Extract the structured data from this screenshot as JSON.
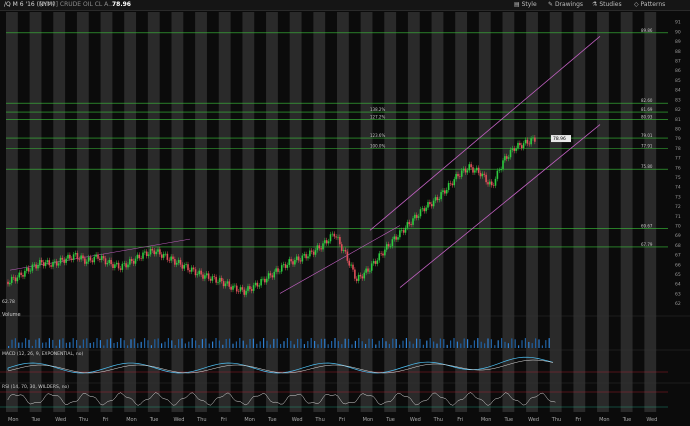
{
  "header": {
    "symbol": "/Q M 6 '16 (NYM)",
    "description": "[NYM] CRUDE OIL CL A...",
    "last_price": "78.96",
    "buttons": [
      {
        "label": "Style",
        "icon": "style-icon"
      },
      {
        "label": "Drawings",
        "icon": "pencil-icon"
      },
      {
        "label": "Studies",
        "icon": "flask-icon"
      },
      {
        "label": "Patterns",
        "icon": "patterns-icon"
      }
    ]
  },
  "lower_panes": {
    "volume_label": "Volume",
    "macd_label": "MACD (12, 26, 9, EXPONENTIAL, no)",
    "rsi_label": "RSI (14, 70, 30, WILDERS, no)"
  },
  "colors": {
    "up": "#2ecc40",
    "down": "#e0505a",
    "fib_line": "#3bbf3b",
    "channel": "#c060c0",
    "session_band": "#2a2a2a",
    "background": "#0b0b0b"
  },
  "chart_data": {
    "type": "candlestick",
    "ylim": [
      61.5,
      92
    ],
    "price_axis_ticks": [
      62,
      63,
      64,
      65,
      66,
      67,
      68,
      69,
      70,
      71,
      72,
      73,
      74,
      75,
      76,
      77,
      78,
      79,
      80,
      81,
      82,
      83,
      84,
      85,
      86,
      87,
      88,
      89,
      90,
      91
    ],
    "x_labels": [
      "Mon",
      "Tue",
      "Wed",
      "Thu",
      "Fri",
      "Mon",
      "Tue",
      "Wed",
      "Thu",
      "Fri",
      "Mon",
      "Tue",
      "Wed",
      "Thu",
      "Fri",
      "Mon",
      "Tue",
      "Wed",
      "Thu",
      "Fri",
      "Mon",
      "Tue",
      "Wed",
      "Thu",
      "Fri",
      "Mon",
      "Tue",
      "Wed"
    ],
    "close_series": [
      64.2,
      64.8,
      65.6,
      66.2,
      66.0,
      66.5,
      66.9,
      66.3,
      66.8,
      66.1,
      65.7,
      66.3,
      67.0,
      67.4,
      66.8,
      66.2,
      65.6,
      65.0,
      64.6,
      64.2,
      63.6,
      63.2,
      63.8,
      64.6,
      65.4,
      66.2,
      66.6,
      67.2,
      68.0,
      69.2,
      67.0,
      64.4,
      65.4,
      66.8,
      68.2,
      69.4,
      70.6,
      71.8,
      72.6,
      73.8,
      75.2,
      76.0,
      75.4,
      74.0,
      76.6,
      78.0,
      78.5,
      79.0
    ],
    "fib_levels": [
      {
        "price": 81.69,
        "label": "138.2%"
      },
      {
        "price": 80.93,
        "label": "127.2%"
      },
      {
        "price": 79.01,
        "label": "123.6%"
      },
      {
        "price": 77.91,
        "label": "100.0%"
      },
      {
        "price": 75.8,
        "label": ""
      },
      {
        "price": 69.67,
        "label": ""
      },
      {
        "price": 67.79,
        "label": ""
      },
      {
        "price": 89.86,
        "label": ""
      },
      {
        "price": 82.6,
        "label": ""
      }
    ],
    "last_price_label": "78.96",
    "low_label": "62.78"
  }
}
